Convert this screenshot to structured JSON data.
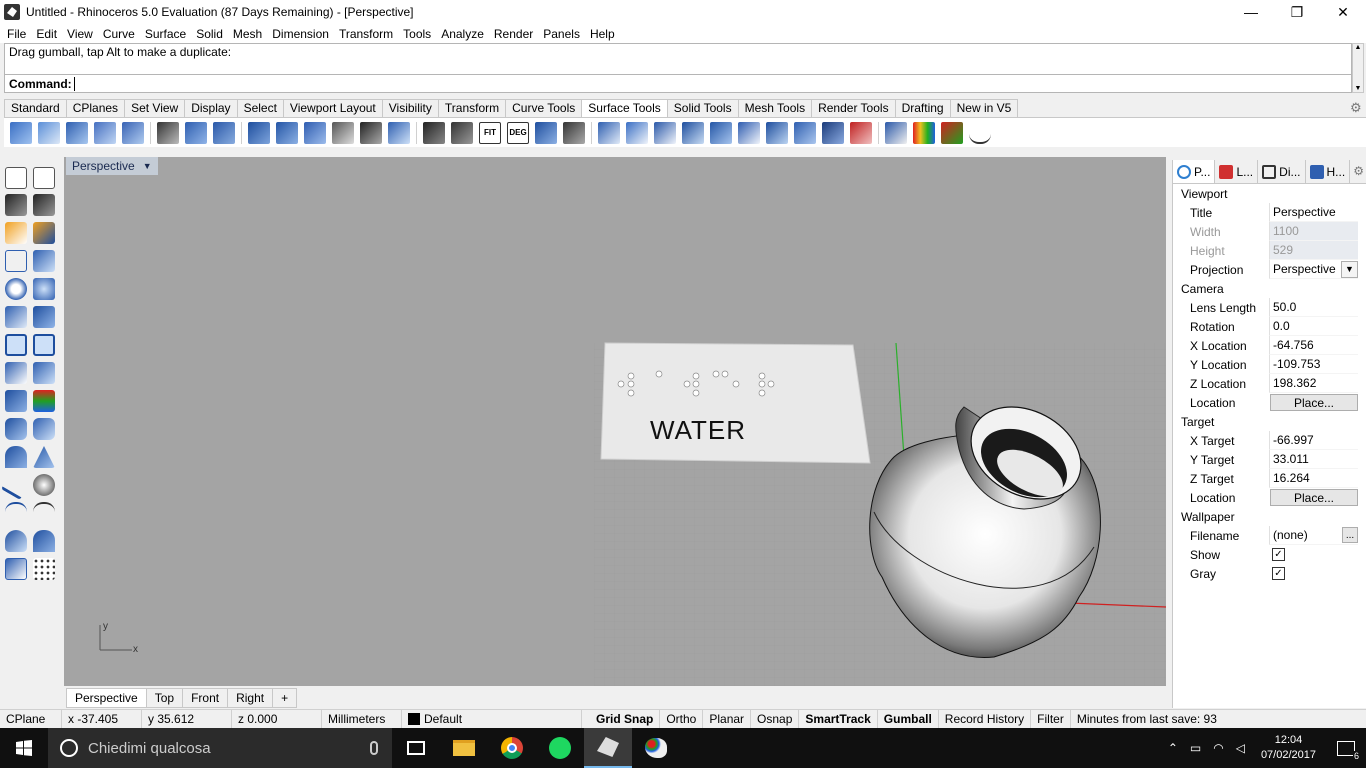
{
  "window": {
    "title": "Untitled - Rhinoceros 5.0 Evaluation (87 Days Remaining) - [Perspective]",
    "minimize": "—",
    "maximize": "❐",
    "close": "✕"
  },
  "menu": [
    "File",
    "Edit",
    "View",
    "Curve",
    "Surface",
    "Solid",
    "Mesh",
    "Dimension",
    "Transform",
    "Tools",
    "Analyze",
    "Render",
    "Panels",
    "Help"
  ],
  "command": {
    "history": "Drag gumball, tap Alt to make a duplicate:",
    "prompt": "Command:",
    "value": ""
  },
  "toolbar_tabs": [
    "Standard",
    "CPlanes",
    "Set View",
    "Display",
    "Select",
    "Viewport Layout",
    "Visibility",
    "Transform",
    "Curve Tools",
    "Surface Tools",
    "Solid Tools",
    "Mesh Tools",
    "Render Tools",
    "Drafting",
    "New in V5"
  ],
  "active_toolbar_tab": "Surface Tools",
  "toolbar_icon_texts": {
    "fit": "FIT",
    "deg": "DEG"
  },
  "viewport": {
    "title": "Perspective",
    "sign_text": "WATER",
    "axis_y": "y",
    "axis_x": "x"
  },
  "viewport_tabs": [
    "Perspective",
    "Top",
    "Front",
    "Right"
  ],
  "viewport_add": "+",
  "status": {
    "cplane": "CPlane",
    "x": "x -37.405",
    "y": "y 35.612",
    "z": "z 0.000",
    "units": "Millimeters",
    "layer": "Default",
    "grid_snap": "Grid Snap",
    "ortho": "Ortho",
    "planar": "Planar",
    "osnap": "Osnap",
    "smarttrack": "SmartTrack",
    "gumball": "Gumball",
    "record_history": "Record History",
    "filter": "Filter",
    "minutes": "Minutes from last save: 93"
  },
  "panel": {
    "tabs": [
      "P...",
      "L...",
      "Di...",
      "H..."
    ],
    "viewport_section": "Viewport",
    "title_label": "Title",
    "title_value": "Perspective",
    "width_label": "Width",
    "width_value": "1100",
    "height_label": "Height",
    "height_value": "529",
    "projection_label": "Projection",
    "projection_value": "Perspective",
    "camera_section": "Camera",
    "lens_label": "Lens Length",
    "lens_value": "50.0",
    "rotation_label": "Rotation",
    "rotation_value": "0.0",
    "cx_label": "X Location",
    "cx_value": "-64.756",
    "cy_label": "Y Location",
    "cy_value": "-109.753",
    "cz_label": "Z Location",
    "cz_value": "198.362",
    "location_label": "Location",
    "place_label": "Place...",
    "target_section": "Target",
    "tx_label": "X Target",
    "tx_value": "-66.997",
    "ty_label": "Y Target",
    "ty_value": "33.011",
    "tz_label": "Z Target",
    "tz_value": "16.264",
    "wallpaper_section": "Wallpaper",
    "filename_label": "Filename",
    "filename_value": "(none)",
    "dots": "...",
    "show_label": "Show",
    "gray_label": "Gray",
    "check": "✓"
  },
  "taskbar": {
    "search_placeholder": "Chiedimi qualcosa",
    "time": "12:04",
    "date": "07/02/2017",
    "notification_count": "6"
  }
}
